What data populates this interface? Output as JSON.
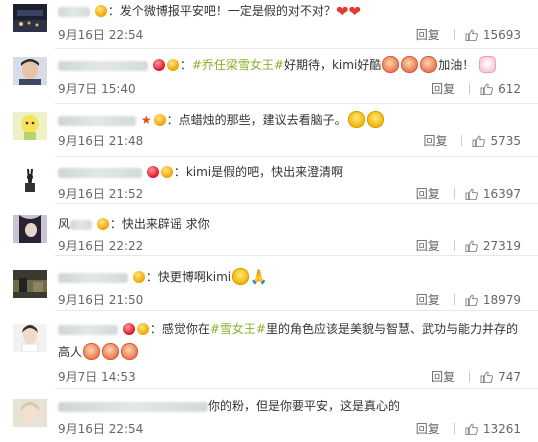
{
  "comments": [
    {
      "text": "：发个微博报平安吧！一定是假的对不对？",
      "date": "9月16日 22:54",
      "reply": "回复",
      "likes": "15693"
    },
    {
      "topic": "#乔任梁雪女王#",
      "text": "好期待，kimi好酷",
      "text2": "加油！",
      "date": "9月7日 15:40",
      "reply": "回复",
      "likes": "612"
    },
    {
      "text": "：点蜡烛的那些，建议去看脑子。",
      "date": "9月16日 21:48",
      "reply": "回复",
      "likes": "5735"
    },
    {
      "text": "：kimi是假的吧，快出来澄清啊",
      "date": "9月16日 21:52",
      "reply": "回复",
      "likes": "16397"
    },
    {
      "name_visible": "风",
      "text": "：快出来辟谣   求你",
      "date": "9月16日 22:22",
      "reply": "回复",
      "likes": "27319"
    },
    {
      "text": "：快更博啊kimi",
      "date": "9月16日 21:50",
      "reply": "回复",
      "likes": "18979"
    },
    {
      "text_a": "：感觉你在",
      "topic": "#雪女王#",
      "text_b": "里的角色应该是美貌与智慧、武功与能力并存的",
      "text_c": "高人",
      "date": "9月7日 14:53",
      "reply": "回复",
      "likes": "747"
    },
    {
      "text": "你的粉，但是你要平安，这是真心的",
      "date": "9月16日 22:54",
      "reply": "回复",
      "likes": "13261"
    }
  ]
}
